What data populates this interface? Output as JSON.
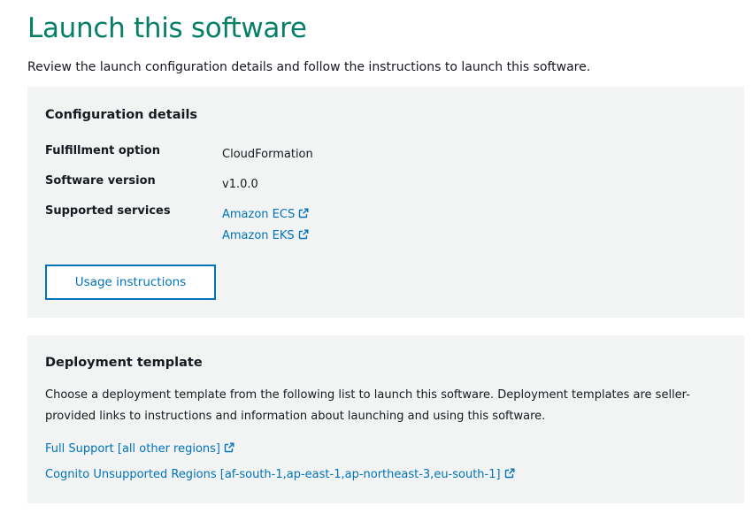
{
  "header": {
    "title": "Launch this software",
    "subtitle": "Review the launch configuration details and follow the instructions to launch this software."
  },
  "configuration": {
    "heading": "Configuration details",
    "rows": [
      {
        "label": "Fulfillment option",
        "value": "CloudFormation"
      },
      {
        "label": "Software version",
        "value": "v1.0.0"
      },
      {
        "label": "Supported services",
        "value": ""
      }
    ],
    "supported_services": [
      {
        "label": "Amazon ECS",
        "icon": "external-link-icon"
      },
      {
        "label": "Amazon EKS",
        "icon": "external-link-icon"
      }
    ],
    "usage_button_label": "Usage instructions"
  },
  "deployment": {
    "heading": "Deployment template",
    "description": "Choose a deployment template from the following list to launch this software. Deployment templates are seller-provided links to instructions and information about launching and using this software.",
    "templates": [
      {
        "label": "Full Support [all other regions]",
        "icon": "external-link-icon"
      },
      {
        "label": "Cognito Unsupported Regions [af-south-1,ap-east-1,ap-northeast-3,eu-south-1]",
        "icon": "external-link-icon"
      }
    ]
  },
  "colors": {
    "title": "#067f68",
    "link": "#0073bb",
    "panel_bg": "#f2f3f3",
    "text": "#16191f"
  }
}
